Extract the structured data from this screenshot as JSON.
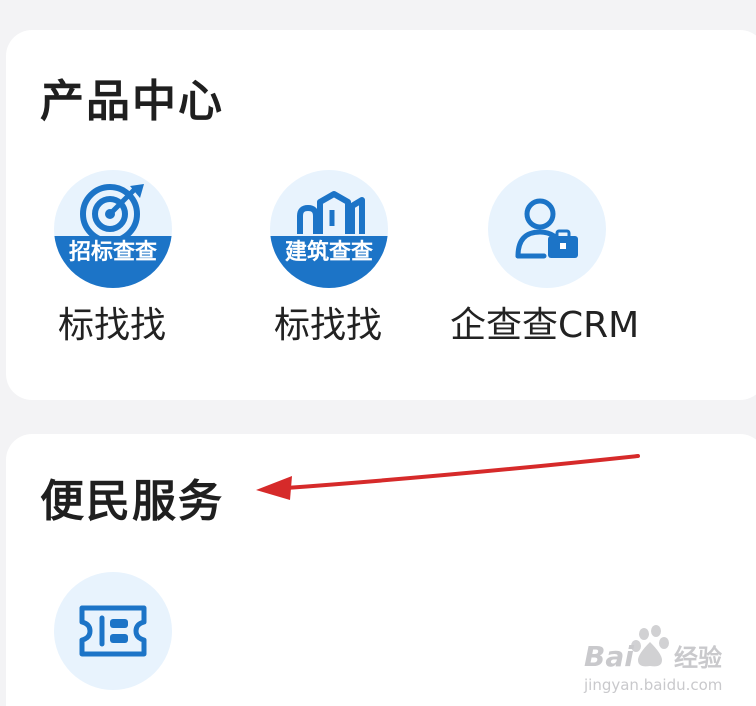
{
  "product_center": {
    "title": "产品中心",
    "apps": [
      {
        "label": "标找找",
        "icon": "bid-target-icon",
        "icon_text": "招标查查"
      },
      {
        "label": "标找找",
        "icon": "building-icon",
        "icon_text": "建筑查查"
      },
      {
        "label": "企查查CRM",
        "icon": "crm-user-icon"
      }
    ]
  },
  "public_service": {
    "title": "便民服务",
    "apps": [
      {
        "icon": "ticket-icon"
      }
    ]
  },
  "watermark": {
    "brand": "Baidu经验",
    "domain": "jingyan.baidu.com"
  },
  "colors": {
    "background": "#f3f3f5",
    "card": "#ffffff",
    "icon_circle": "#e8f3fd",
    "brand_blue": "#1c74c7",
    "arrow_red": "#d62a2a"
  }
}
